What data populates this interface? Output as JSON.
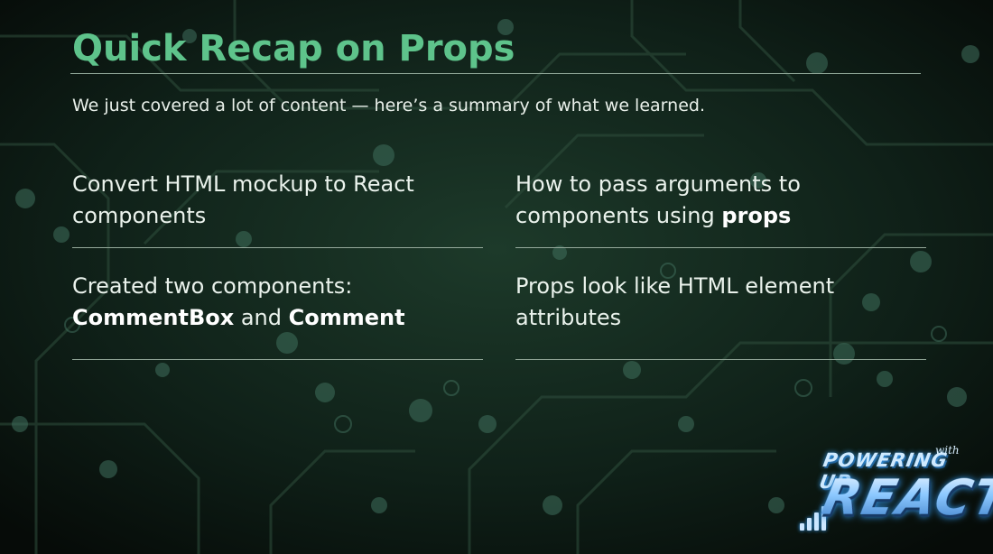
{
  "slide": {
    "title": "Quick Recap on Props",
    "subtitle": "We just covered a lot of content — here’s a summary of what we learned."
  },
  "cards": [
    {
      "line1": "Convert HTML mockup to React",
      "line2": "components"
    },
    {
      "line1": "How to pass arguments to",
      "line2_pre": "components using ",
      "line2_bold": "props"
    },
    {
      "line1": "Created two components:",
      "bold1": "CommentBox",
      "mid": " and ",
      "bold2": "Comment"
    },
    {
      "line1": "Props look like HTML element",
      "line2": "attributes"
    }
  ],
  "logo": {
    "line1": "POWERING UP",
    "with": "with",
    "line2": "REACT"
  },
  "colors": {
    "title": "#5ec38b",
    "background": "#0b1510",
    "text": "#eaf2ec",
    "rule": "#95a99b"
  }
}
